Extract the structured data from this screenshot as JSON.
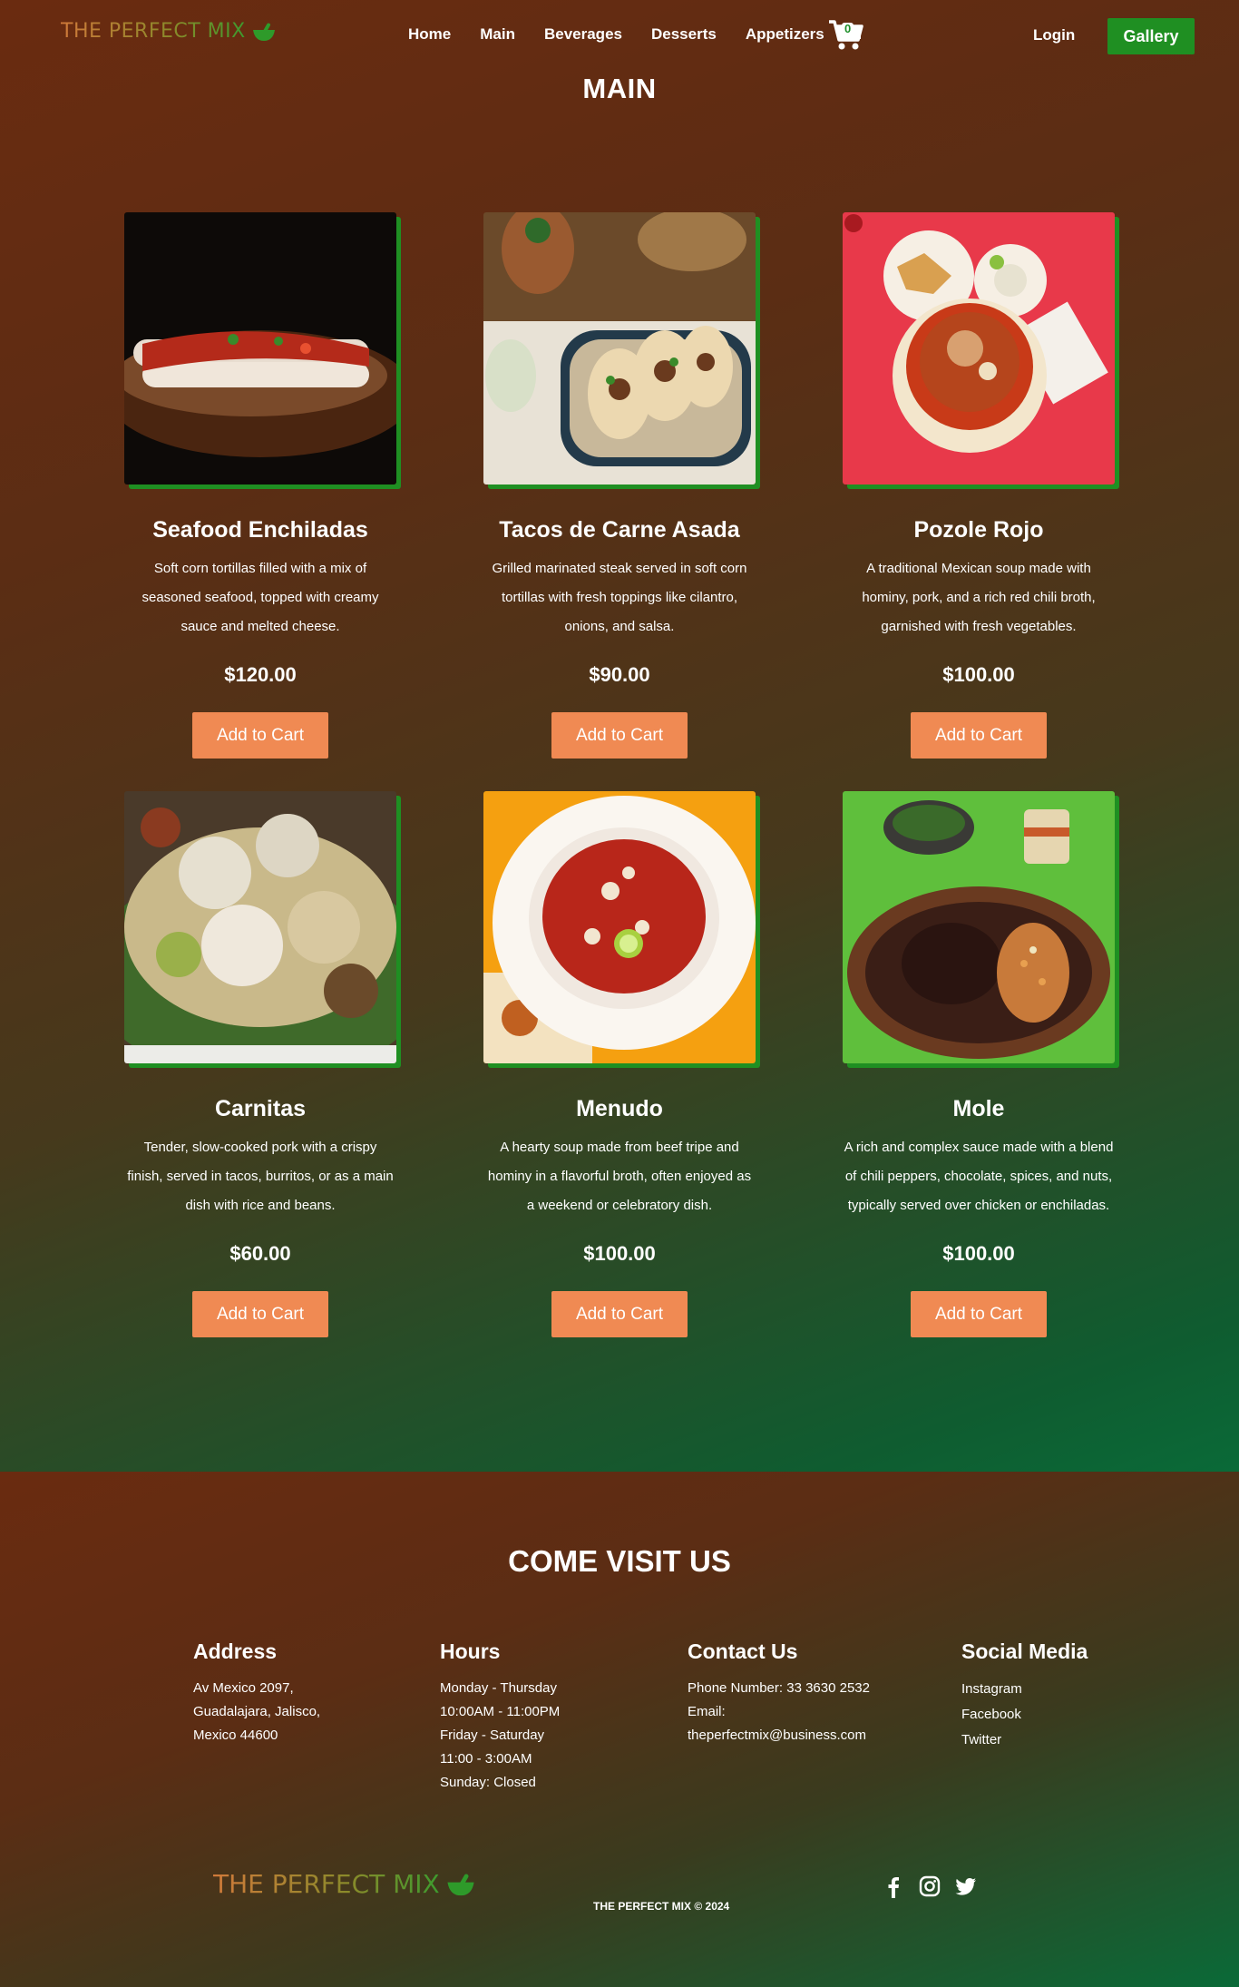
{
  "brand": {
    "name": "THE PERFECT MIX",
    "icon": "mortar-bowl-icon"
  },
  "nav": {
    "items": [
      {
        "label": "Home"
      },
      {
        "label": "Main"
      },
      {
        "label": "Beverages"
      },
      {
        "label": "Desserts"
      },
      {
        "label": "Appetizers"
      }
    ],
    "cart_count": "0",
    "login_label": "Login",
    "gallery_label": "Gallery"
  },
  "section_title": "MAIN",
  "colors": {
    "accent_green": "#1f8f22",
    "button_orange": "#f08a53"
  },
  "dishes": [
    {
      "name": "Seafood Enchiladas",
      "description": "Soft corn tortillas filled with a mix of seasoned seafood, topped with creamy sauce and melted cheese.",
      "price": "$120.00",
      "button": "Add to Cart"
    },
    {
      "name": "Tacos de Carne Asada",
      "description": "Grilled marinated steak served in soft corn tortillas with fresh toppings like cilantro, onions, and salsa.",
      "price": "$90.00",
      "button": "Add to Cart"
    },
    {
      "name": "Pozole Rojo",
      "description": "A traditional Mexican soup made with hominy, pork, and a rich red chili broth, garnished with fresh vegetables.",
      "price": "$100.00",
      "button": "Add to Cart"
    },
    {
      "name": "Carnitas",
      "description": "Tender, slow-cooked pork with a crispy finish, served in tacos, burritos, or as a main dish with rice and beans.",
      "price": "$60.00",
      "button": "Add to Cart"
    },
    {
      "name": "Menudo",
      "description": "A hearty soup made from beef tripe and hominy in a flavorful broth, often enjoyed as a weekend or celebratory dish.",
      "price": "$100.00",
      "button": "Add to Cart"
    },
    {
      "name": "Mole",
      "description": "A rich and complex sauce made with a blend of chili peppers, chocolate, spices, and nuts, typically served over chicken or enchiladas.",
      "price": "$100.00",
      "button": "Add to Cart"
    }
  ],
  "footer": {
    "title": "COME VISIT US",
    "address": {
      "heading": "Address",
      "lines": [
        "Av Mexico 2097,",
        "Guadalajara, Jalisco,",
        "Mexico 44600"
      ]
    },
    "hours": {
      "heading": "Hours",
      "lines": [
        "Monday - Thursday",
        "10:00AM - 11:00PM",
        "Friday - Saturday",
        "11:00 - 3:00AM",
        "Sunday: Closed"
      ]
    },
    "contact": {
      "heading": "Contact Us",
      "lines": [
        "Phone Number: 33 3630 2532",
        "Email:",
        "theperfectmix@business.com"
      ]
    },
    "social": {
      "heading": "Social Media",
      "links": [
        "Instagram",
        "Facebook",
        "Twitter"
      ]
    },
    "copyright": "THE PERFECT MIX © 2024",
    "social_icons": [
      "facebook-icon",
      "instagram-icon",
      "twitter-icon"
    ]
  }
}
